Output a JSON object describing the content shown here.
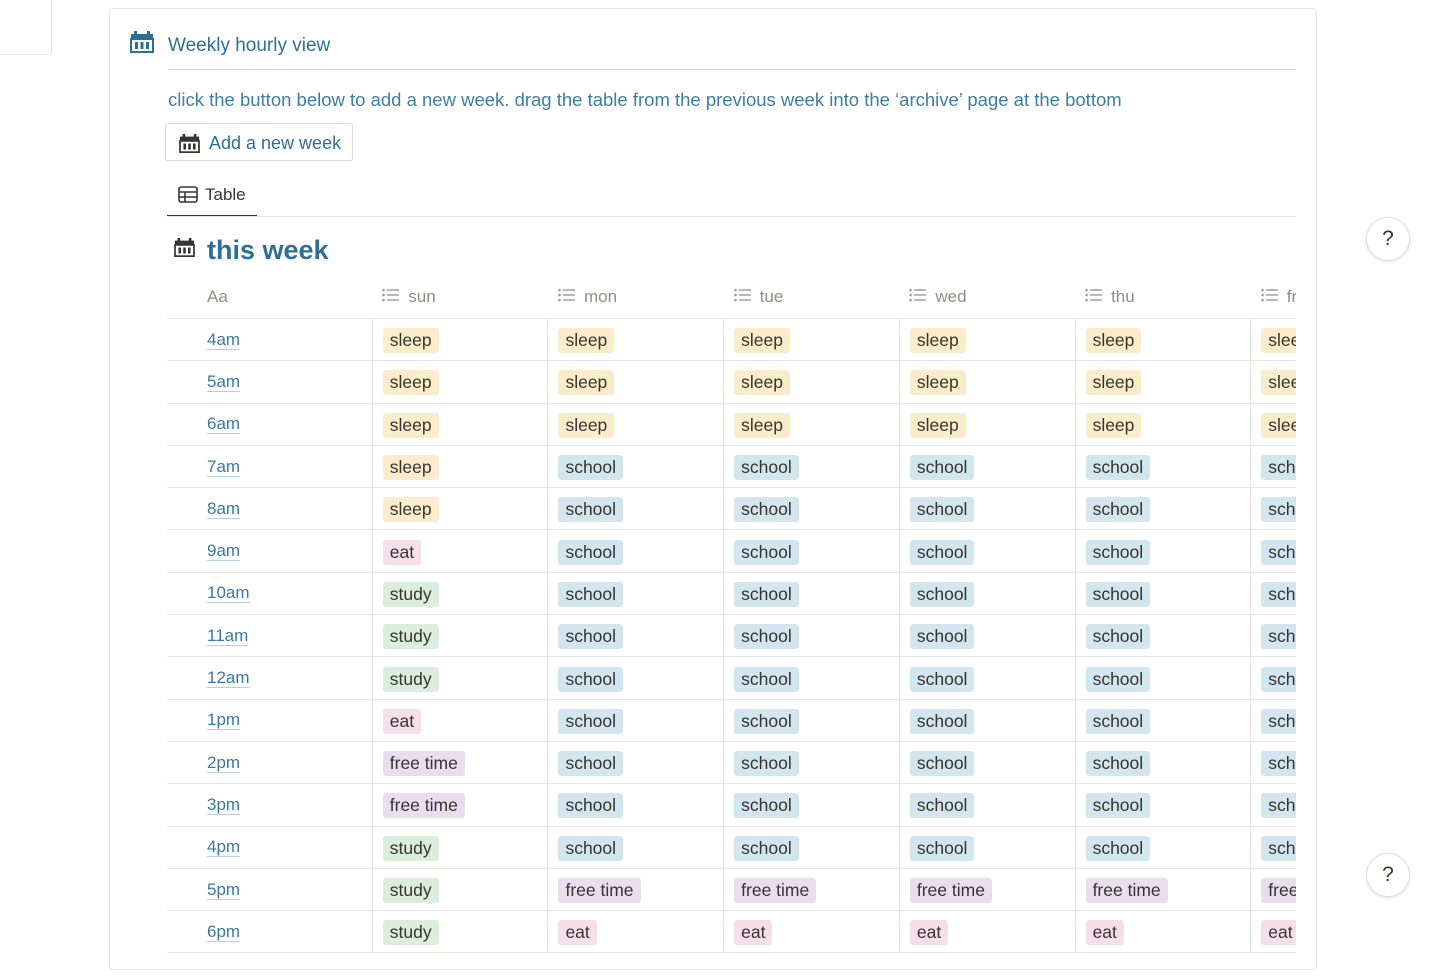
{
  "section": {
    "title": "Weekly hourly view",
    "instructions": "click the button below to add a new week. drag the table from the previous week into the ‘archive’ page at the bottom",
    "add_button_label": "Add a new week"
  },
  "views": [
    {
      "label": "Table",
      "active": true
    }
  ],
  "database": {
    "title": "this week",
    "title_column": "Aa",
    "columns": [
      "sun",
      "mon",
      "tue",
      "wed",
      "thu",
      "fri"
    ],
    "rows": [
      {
        "time": "4am",
        "cells": [
          "sleep",
          "sleep",
          "sleep",
          "sleep",
          "sleep",
          "sleep"
        ]
      },
      {
        "time": "5am",
        "cells": [
          "sleep",
          "sleep",
          "sleep",
          "sleep",
          "sleep",
          "sleep"
        ]
      },
      {
        "time": "6am",
        "cells": [
          "sleep",
          "sleep",
          "sleep",
          "sleep",
          "sleep",
          "sleep"
        ]
      },
      {
        "time": "7am",
        "cells": [
          "sleep",
          "school",
          "school",
          "school",
          "school",
          "school"
        ]
      },
      {
        "time": "8am",
        "cells": [
          "sleep",
          "school",
          "school",
          "school",
          "school",
          "school"
        ]
      },
      {
        "time": "9am",
        "cells": [
          "eat",
          "school",
          "school",
          "school",
          "school",
          "school"
        ]
      },
      {
        "time": "10am",
        "cells": [
          "study",
          "school",
          "school",
          "school",
          "school",
          "school"
        ]
      },
      {
        "time": "11am",
        "cells": [
          "study",
          "school",
          "school",
          "school",
          "school",
          "school"
        ]
      },
      {
        "time": "12am",
        "cells": [
          "study",
          "school",
          "school",
          "school",
          "school",
          "school"
        ]
      },
      {
        "time": "1pm",
        "cells": [
          "eat",
          "school",
          "school",
          "school",
          "school",
          "school"
        ]
      },
      {
        "time": "2pm",
        "cells": [
          "free time",
          "school",
          "school",
          "school",
          "school",
          "school"
        ]
      },
      {
        "time": "3pm",
        "cells": [
          "free time",
          "school",
          "school",
          "school",
          "school",
          "school"
        ]
      },
      {
        "time": "4pm",
        "cells": [
          "study",
          "school",
          "school",
          "school",
          "school",
          "school"
        ]
      },
      {
        "time": "5pm",
        "cells": [
          "study",
          "free time",
          "free time",
          "free time",
          "free time",
          "free time"
        ]
      },
      {
        "time": "6pm",
        "cells": [
          "study",
          "eat",
          "eat",
          "eat",
          "eat",
          "eat"
        ]
      }
    ]
  },
  "tag_colors": {
    "sleep": "#fbeccc",
    "school": "#d3e5ef",
    "eat": "#f5e0e9",
    "study": "#dbeddb",
    "free time": "#e8deee"
  },
  "accent_color": "#2f6f96",
  "help_buttons": [
    "?",
    "?"
  ],
  "icons": {
    "section": "calendar-icon",
    "add_button": "calendar-icon",
    "view_tab": "table-icon",
    "database": "calendar-icon",
    "column": "list-icon"
  }
}
